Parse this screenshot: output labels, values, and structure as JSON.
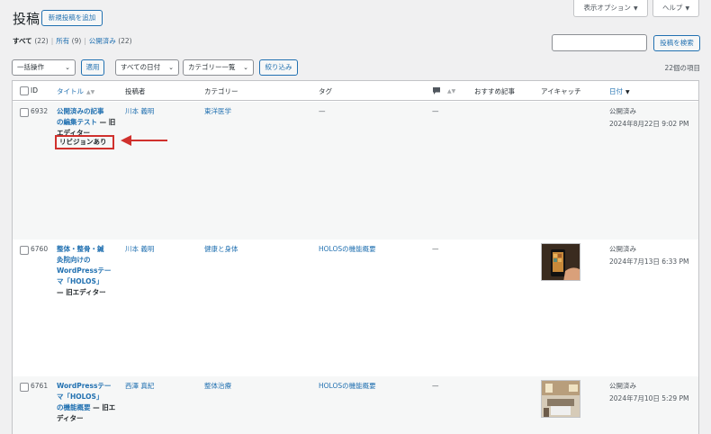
{
  "header": {
    "title": "投稿",
    "add_new": "新規投稿を追加",
    "screen_options": "表示オプション",
    "help": "ヘルプ"
  },
  "views": {
    "all": "すべて",
    "all_count": "(22)",
    "mine": "所有",
    "mine_count": "(9)",
    "published": "公開済み",
    "published_count": "(22)"
  },
  "search": {
    "value": "",
    "button": "投稿を検索"
  },
  "filters": {
    "bulk": "一括操作",
    "apply": "適用",
    "date": "すべての日付",
    "category": "カテゴリー一覧",
    "filter": "絞り込み"
  },
  "items_count": "22個の項目",
  "columns": {
    "id": "ID",
    "title": "タイトル",
    "author": "投稿者",
    "category": "カテゴリー",
    "tags": "タグ",
    "featured": "おすすめ記事",
    "eyecatch": "アイキャッチ",
    "date": "日付"
  },
  "rows": [
    {
      "id": "6932",
      "title_lines": [
        "公開済みの記事",
        "の編集テスト"
      ],
      "state_suffix": " — 旧エディター",
      "badge": "リビジョンあり",
      "author": "川本 義明",
      "category": "東洋医学",
      "tags": "—",
      "comments": "—",
      "status": "公開済み",
      "date": "2024年8月22日 9:02 PM",
      "thumbnail": "none"
    },
    {
      "id": "6760",
      "title_lines": [
        "整体・整骨・鍼",
        "灸院向けの",
        "WordPressテー",
        "マ「HOLOS」"
      ],
      "state_suffix": "— 旧エディター",
      "author": "川本 義明",
      "category": "健康と身体",
      "tags": "HOLOSの機能概要",
      "comments": "—",
      "status": "公開済み",
      "date": "2024年7月13日 6:33 PM",
      "thumbnail": "phone-photo"
    },
    {
      "id": "6761",
      "title_lines": [
        "WordPressテー",
        "マ「HOLOS」",
        "の機能概要"
      ],
      "state_suffix": " — 旧エディター",
      "author": "西澤 真紀",
      "category": "整体治療",
      "tags": "HOLOSの機能概要",
      "comments": "—",
      "status": "公開済み",
      "date": "2024年7月10日 5:29 PM",
      "thumbnail": "room-photo"
    }
  ],
  "annotation_color": "#d0312d"
}
